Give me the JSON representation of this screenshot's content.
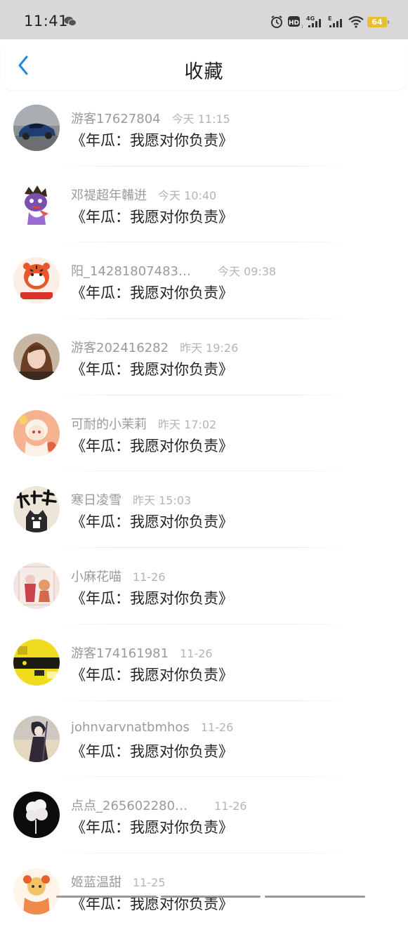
{
  "status_bar": {
    "time": "11:41",
    "battery": "64",
    "icons": [
      "wechat-icon",
      "alarm-icon",
      "hd-icon",
      "signal-4g-icon",
      "signal-e-icon",
      "wifi-icon",
      "battery-icon"
    ],
    "battery_color": "#e8c22d"
  },
  "header": {
    "title": "收藏",
    "back_icon": "chevron-left-icon",
    "accent": "#1e88e5"
  },
  "items": [
    {
      "user": "游客17627804",
      "time": "今天 11:15",
      "title": "《年瓜：我愿对你负责》",
      "avatar": "car-avatar"
    },
    {
      "user": "邓禔超年韛逬",
      "time": "今天 10:40",
      "title": "《年瓜：我愿对你负责》",
      "avatar": "cartoon-monster-avatar"
    },
    {
      "user": "阳_14281807483…",
      "time": "今天 09:38",
      "title": "《年瓜：我愿对你负责》",
      "avatar": "tiger-avatar"
    },
    {
      "user": "游客202416282",
      "time": "昨天 19:26",
      "title": "《年瓜：我愿对你负责》",
      "avatar": "girl-photo-avatar"
    },
    {
      "user": "可耐的小茉莉",
      "time": "昨天 17:02",
      "title": "《年瓜：我愿对你负责》",
      "avatar": "anime-girl-avatar"
    },
    {
      "user": "寒日凌雪",
      "time": "昨天 15:03",
      "title": "《年瓜：我愿对你负责》",
      "avatar": "cat-calligraphy-avatar"
    },
    {
      "user": "小麻花喵",
      "time": "11-26",
      "title": "《年瓜：我愿对你负责》",
      "avatar": "illustration-avatar"
    },
    {
      "user": "游客174161981",
      "time": "11-26",
      "title": "《年瓜：我愿对你负责》",
      "avatar": "yellow-scene-avatar"
    },
    {
      "user": "johnvarvnatbmhos",
      "time": "11-26",
      "title": "《年瓜：我愿对你负责》",
      "avatar": "dark-anime-avatar"
    },
    {
      "user": "点点_265602280…",
      "time": "11-26",
      "title": "《年瓜：我愿对你负责》",
      "avatar": "white-cloud-avatar"
    },
    {
      "user": "姬蓝温甜",
      "time": "11-25",
      "title": "《年瓜：我愿对你负责》",
      "avatar": "colorful-cartoon-avatar"
    }
  ]
}
